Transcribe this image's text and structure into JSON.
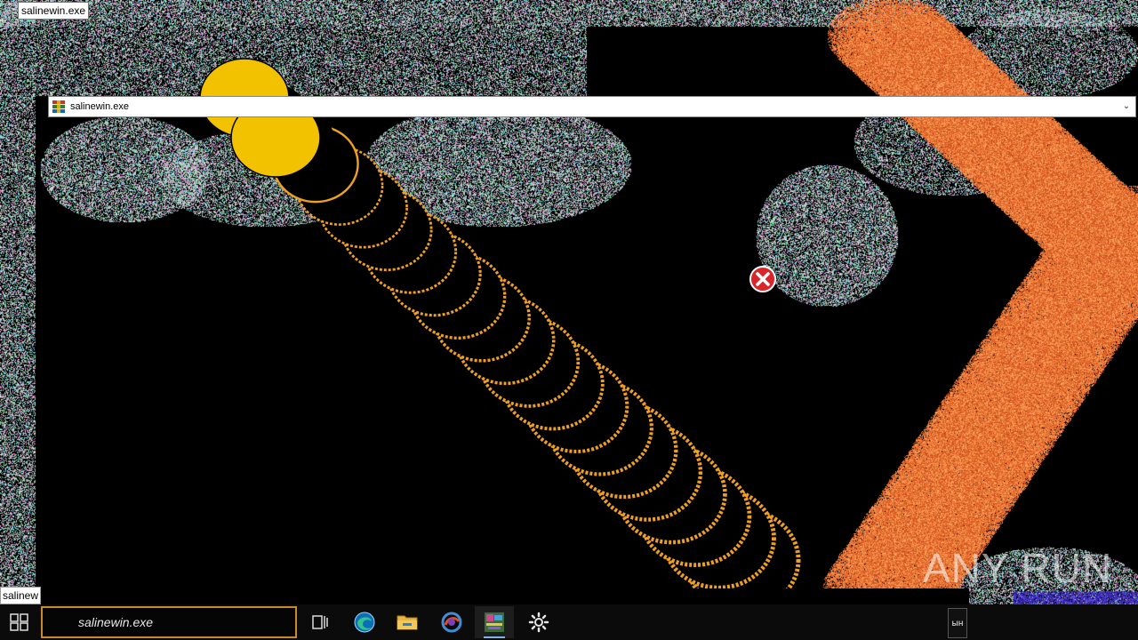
{
  "window": {
    "top_title": "salinewin.exe",
    "bar_title": "salinewin.exe"
  },
  "tooltip": {
    "text": "salinew"
  },
  "taskbar": {
    "search_text": "salinewin.exe",
    "tray_fragment": "ын",
    "icons": [
      "start-icon",
      "task-view-icon",
      "edge-icon",
      "file-explorer-icon",
      "app-icon",
      "active-app-icon",
      "settings-icon"
    ]
  },
  "watermark": {
    "text": "ANY RUN"
  },
  "colors": {
    "background": "#000000",
    "yellow": "#f2c100",
    "orange": "#e05a1a",
    "taskbar": "#0b0b0b",
    "search_border": "#c98a2a",
    "error_red": "#d9262b"
  }
}
